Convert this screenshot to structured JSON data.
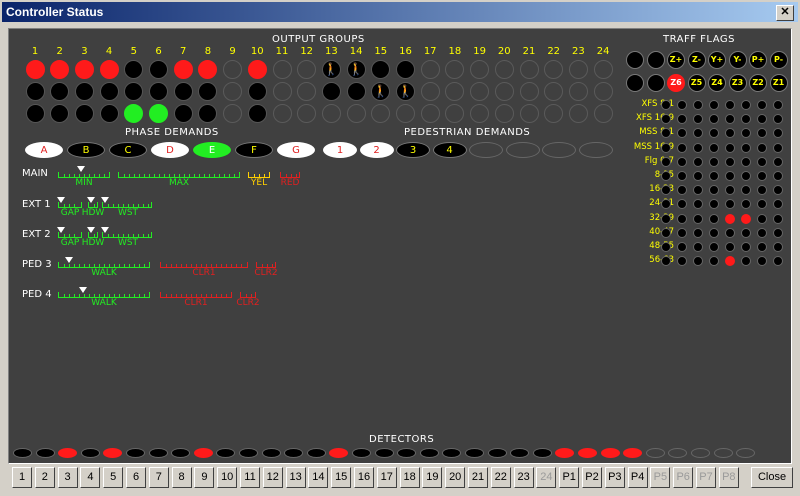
{
  "window": {
    "title": "Controller Status",
    "close_glyph": "✕"
  },
  "sections": {
    "output_groups": "OUTPUT GROUPS",
    "traff_flags": "TRAFF FLAGS",
    "phase_demands": "PHASE DEMANDS",
    "pedestrian_demands": "PEDESTRIAN DEMANDS",
    "detectors": "DETECTORS"
  },
  "output_groups": {
    "numbers": [
      "1",
      "2",
      "3",
      "4",
      "5",
      "6",
      "7",
      "8",
      "9",
      "10",
      "11",
      "12",
      "13",
      "14",
      "15",
      "16",
      "17",
      "18",
      "19",
      "20",
      "21",
      "22",
      "23",
      "24"
    ],
    "row1": [
      "red",
      "red",
      "red",
      "red",
      "black",
      "black",
      "red",
      "red",
      "empty",
      "red",
      "empty",
      "empty",
      "ped-red",
      "ped-red",
      "black",
      "black",
      "empty",
      "empty",
      "empty",
      "empty",
      "empty",
      "empty",
      "empty",
      "empty"
    ],
    "row2": [
      "black",
      "black",
      "black",
      "black",
      "black",
      "black",
      "black",
      "black",
      "empty",
      "black",
      "empty",
      "empty",
      "black",
      "black",
      "ped-green",
      "ped-green",
      "empty",
      "empty",
      "empty",
      "empty",
      "empty",
      "empty",
      "empty",
      "empty"
    ],
    "row3": [
      "black",
      "black",
      "black",
      "black",
      "green",
      "green",
      "black",
      "black",
      "empty",
      "black",
      "empty",
      "empty",
      "empty",
      "empty",
      "empty",
      "empty",
      "empty",
      "empty",
      "empty",
      "empty",
      "empty",
      "empty",
      "empty",
      "empty"
    ]
  },
  "phase_demands": [
    {
      "label": "A",
      "state": "white"
    },
    {
      "label": "B",
      "state": "black"
    },
    {
      "label": "C",
      "state": "black"
    },
    {
      "label": "D",
      "state": "white"
    },
    {
      "label": "E",
      "state": "green"
    },
    {
      "label": "F",
      "state": "black"
    },
    {
      "label": "G",
      "state": "white"
    }
  ],
  "pedestrian_demands": [
    {
      "label": "1",
      "state": "white"
    },
    {
      "label": "2",
      "state": "white"
    },
    {
      "label": "3",
      "state": "black"
    },
    {
      "label": "4",
      "state": "black"
    },
    {
      "label": "",
      "state": "empty"
    },
    {
      "label": "",
      "state": "empty"
    },
    {
      "label": "",
      "state": "empty"
    },
    {
      "label": "",
      "state": "empty"
    }
  ],
  "traff_flags": {
    "row1": [
      {
        "label": "",
        "state": "black"
      },
      {
        "label": "",
        "state": "black"
      },
      {
        "label": "Z+",
        "state": "black"
      },
      {
        "label": "Z-",
        "state": "black"
      },
      {
        "label": "Y+",
        "state": "black"
      },
      {
        "label": "Y-",
        "state": "black"
      },
      {
        "label": "P+",
        "state": "black"
      },
      {
        "label": "P-",
        "state": "black"
      }
    ],
    "row2": [
      {
        "label": "",
        "state": "black"
      },
      {
        "label": "",
        "state": "black"
      },
      {
        "label": "Z6",
        "state": "red"
      },
      {
        "label": "Z5",
        "state": "black"
      },
      {
        "label": "Z4",
        "state": "black"
      },
      {
        "label": "Z3",
        "state": "black"
      },
      {
        "label": "Z2",
        "state": "black"
      },
      {
        "label": "Z1",
        "state": "black"
      }
    ],
    "grid": [
      {
        "label": "XFS 8-1",
        "on": []
      },
      {
        "label": "XFS 16-9",
        "on": []
      },
      {
        "label": "MSS 8-1",
        "on": []
      },
      {
        "label": "MSS 16-9",
        "on": []
      },
      {
        "label": "Flg 0-7",
        "on": []
      },
      {
        "label": "8-15",
        "on": []
      },
      {
        "label": "16-23",
        "on": []
      },
      {
        "label": "24-31",
        "on": []
      },
      {
        "label": "32-39",
        "on": [
          4,
          5
        ]
      },
      {
        "label": "40-47",
        "on": []
      },
      {
        "label": "48-55",
        "on": []
      },
      {
        "label": "56-63",
        "on": [
          4
        ]
      }
    ]
  },
  "timers": {
    "main": {
      "label": "MAIN",
      "min": "MIN",
      "max": "MAX",
      "yel": "YEL",
      "red": "RED"
    },
    "ext1": {
      "label": "EXT  1",
      "gap": "GAP",
      "hdw": "HDW",
      "wst": "WST"
    },
    "ext2": {
      "label": "EXT  2",
      "gap": "GAP",
      "hdw": "HDW",
      "wst": "WST"
    },
    "ped3": {
      "label": "PED  3",
      "walk": "WALK",
      "clr1": "CLR1",
      "clr2": "CLR2"
    },
    "ped4": {
      "label": "PED  4",
      "walk": "WALK",
      "clr1": "CLR1",
      "clr2": "CLR2"
    }
  },
  "detectors": [
    "black",
    "black",
    "red",
    "black",
    "red",
    "black",
    "black",
    "black",
    "red",
    "black",
    "black",
    "black",
    "black",
    "black",
    "red",
    "black",
    "black",
    "black",
    "black",
    "black",
    "black",
    "black",
    "black",
    "black",
    "red",
    "red",
    "red",
    "red",
    "empty",
    "empty",
    "empty",
    "empty",
    "empty"
  ],
  "buttons": [
    {
      "label": "1",
      "enabled": true
    },
    {
      "label": "2",
      "enabled": true
    },
    {
      "label": "3",
      "enabled": true
    },
    {
      "label": "4",
      "enabled": true
    },
    {
      "label": "5",
      "enabled": true
    },
    {
      "label": "6",
      "enabled": true
    },
    {
      "label": "7",
      "enabled": true
    },
    {
      "label": "8",
      "enabled": true
    },
    {
      "label": "9",
      "enabled": true
    },
    {
      "label": "10",
      "enabled": true
    },
    {
      "label": "11",
      "enabled": true
    },
    {
      "label": "12",
      "enabled": true
    },
    {
      "label": "13",
      "enabled": true
    },
    {
      "label": "14",
      "enabled": true
    },
    {
      "label": "15",
      "enabled": true
    },
    {
      "label": "16",
      "enabled": true
    },
    {
      "label": "17",
      "enabled": true
    },
    {
      "label": "18",
      "enabled": true
    },
    {
      "label": "19",
      "enabled": true
    },
    {
      "label": "20",
      "enabled": true
    },
    {
      "label": "21",
      "enabled": true
    },
    {
      "label": "22",
      "enabled": true
    },
    {
      "label": "23",
      "enabled": true
    },
    {
      "label": "24",
      "enabled": false
    },
    {
      "label": "P1",
      "enabled": true
    },
    {
      "label": "P2",
      "enabled": true
    },
    {
      "label": "P3",
      "enabled": true
    },
    {
      "label": "P4",
      "enabled": true
    },
    {
      "label": "P5",
      "enabled": false
    },
    {
      "label": "P6",
      "enabled": false
    },
    {
      "label": "P7",
      "enabled": false
    },
    {
      "label": "P8",
      "enabled": false
    }
  ],
  "close_button": "Close"
}
